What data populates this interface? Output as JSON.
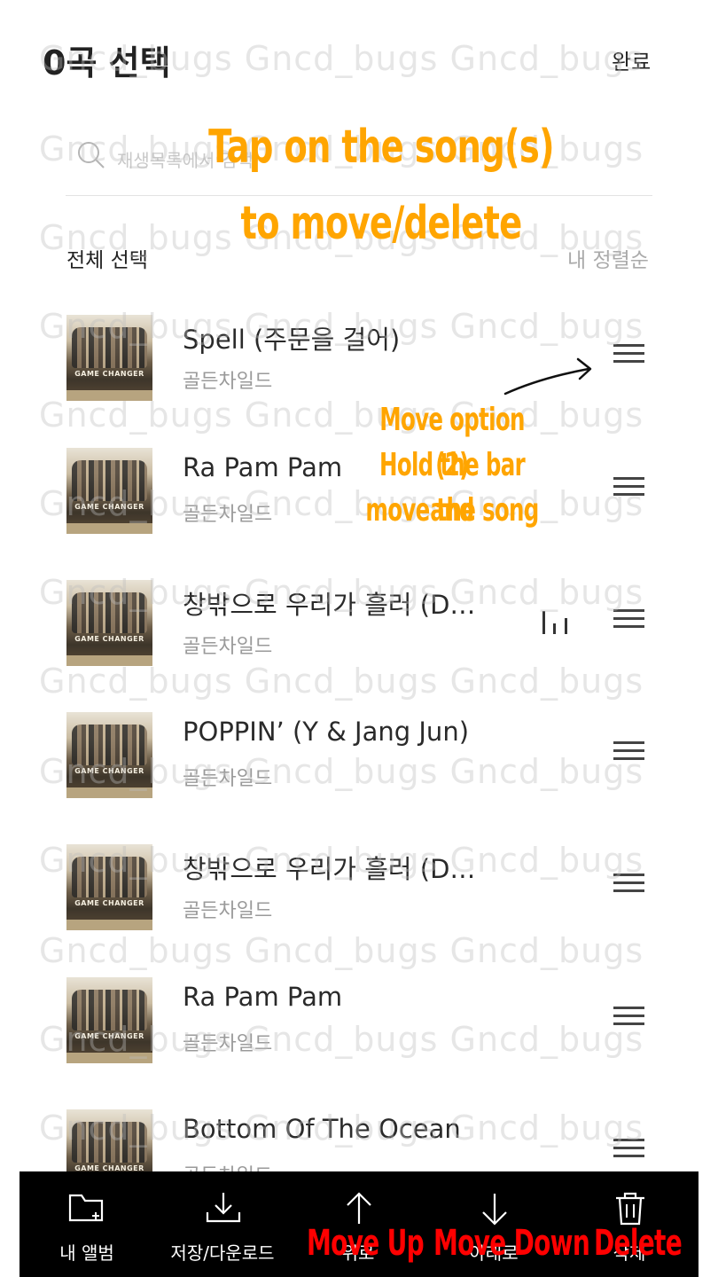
{
  "header": {
    "title": "0곡 선택",
    "done_label": "완료"
  },
  "search": {
    "placeholder": "재생목록에서 검색"
  },
  "toolbar": {
    "select_all": "전체 선택",
    "sort": "내 정렬순"
  },
  "songs": [
    {
      "title": "Spell (주문을 걸어)",
      "artist": "골든차일드",
      "playing": false
    },
    {
      "title": "Ra Pam Pam",
      "artist": "골든차일드",
      "playing": false
    },
    {
      "title": "창밖으로 우리가 흘러 (D…",
      "artist": "골든차일드",
      "playing": true
    },
    {
      "title": "POPPIN’ (Y & Jang Jun)",
      "artist": "골든차일드",
      "playing": false
    },
    {
      "title": "창밖으로 우리가 흘러 (D…",
      "artist": "골든차일드",
      "playing": false
    },
    {
      "title": "Ra Pam Pam",
      "artist": "골든차일드",
      "playing": false
    },
    {
      "title": "Bottom Of The Ocean",
      "artist": "골든차일드",
      "playing": false
    }
  ],
  "album_art_text": "GAME CHANGER",
  "bottom_bar": [
    {
      "label": "내 앨범",
      "icon": "folder-add-icon",
      "overlay": ""
    },
    {
      "label": "저장/다운로드",
      "icon": "download-icon",
      "overlay": ""
    },
    {
      "label": "위로",
      "icon": "arrow-up-icon",
      "overlay": "Move Up"
    },
    {
      "label": "아래로",
      "icon": "arrow-down-icon",
      "overlay": "Move Down"
    },
    {
      "label": "삭제",
      "icon": "trash-icon",
      "overlay": "Delete"
    }
  ],
  "annotations": {
    "tap_line1": "Tap on the song(s)",
    "tap_line2": "to move/delete",
    "move_line1": "Move option (2)",
    "move_line2": "Hold the bar and",
    "move_line3": "move the song"
  },
  "watermark": "Gncd_bugs Gncd_bugs Gncd_bugs",
  "colors": {
    "annotation_orange": "#ffa500",
    "annotation_red": "#ff0000",
    "bottom_bar_bg": "#000000"
  }
}
